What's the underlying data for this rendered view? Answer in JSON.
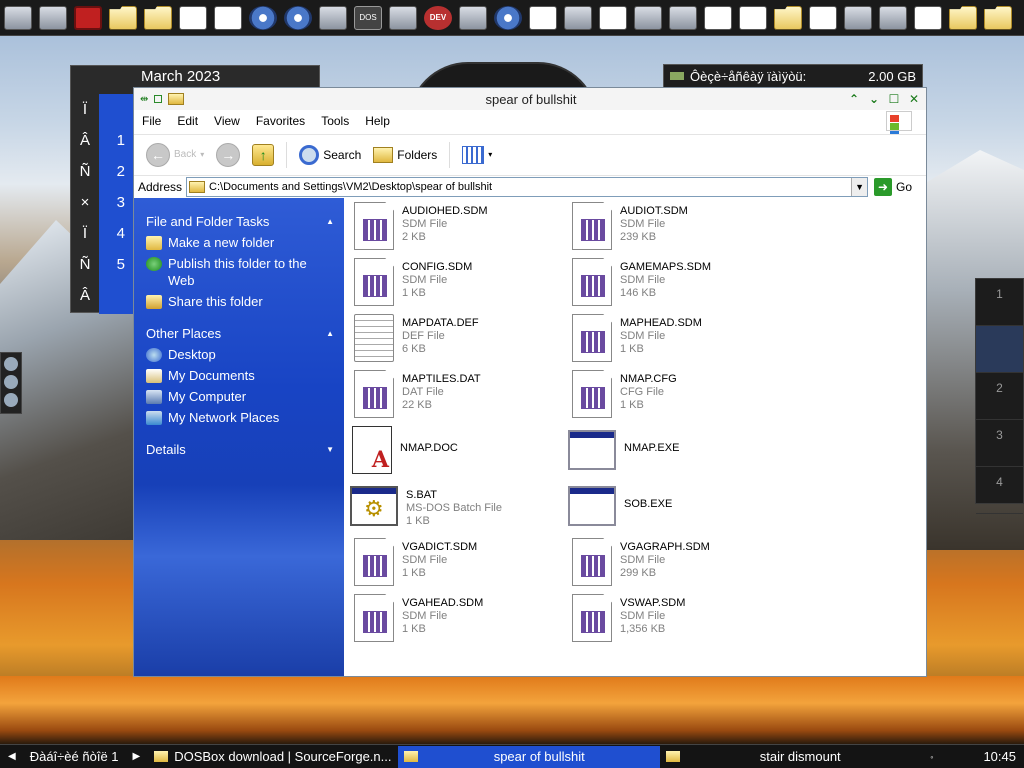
{
  "calendar": {
    "month": "March 2023",
    "weekdays": [
      "Ï",
      "Â",
      "Ñ",
      "×",
      "Ï",
      "Ñ",
      "Â"
    ],
    "dates": [
      "",
      "1",
      "2",
      "3",
      "4",
      "5"
    ]
  },
  "drive": {
    "label": "Ôèçè÷åñêàÿ ïàìÿòü:",
    "size": "2.00 GB"
  },
  "pager": [
    "1",
    "",
    "2",
    "3",
    "4"
  ],
  "window": {
    "title": "spear of bullshit",
    "menu": [
      "File",
      "Edit",
      "View",
      "Favorites",
      "Tools",
      "Help"
    ],
    "toolbar": {
      "back": "Back",
      "search": "Search",
      "folders": "Folders"
    },
    "address": {
      "label": "Address",
      "path": "C:\\Documents and Settings\\VM2\\Desktop\\spear of bullshit",
      "go": "Go"
    }
  },
  "taskpane": {
    "file_tasks": {
      "header": "File and Folder Tasks",
      "items": [
        "Make a new folder",
        "Publish this folder to the Web",
        "Share this folder"
      ]
    },
    "other_places": {
      "header": "Other Places",
      "items": [
        "Desktop",
        "My Documents",
        "My Computer",
        "My Network Places"
      ]
    },
    "details": {
      "header": "Details"
    }
  },
  "files": [
    {
      "name": "AUDIOHED.SDM",
      "type": "SDM File",
      "size": "2 KB"
    },
    {
      "name": "AUDIOT.SDM",
      "type": "SDM File",
      "size": "239 KB"
    },
    {
      "name": "CONFIG.SDM",
      "type": "SDM File",
      "size": "1 KB"
    },
    {
      "name": "GAMEMAPS.SDM",
      "type": "SDM File",
      "size": "146 KB"
    },
    {
      "name": "MAPDATA.DEF",
      "type": "DEF File",
      "size": "6 KB"
    },
    {
      "name": "MAPHEAD.SDM",
      "type": "SDM File",
      "size": "1 KB"
    },
    {
      "name": "MAPTILES.DAT",
      "type": "DAT File",
      "size": "22 KB"
    },
    {
      "name": "NMAP.CFG",
      "type": "CFG File",
      "size": "1 KB"
    },
    {
      "name": "NMAP.DOC",
      "type": "",
      "size": ""
    },
    {
      "name": "NMAP.EXE",
      "type": "",
      "size": ""
    },
    {
      "name": "S.BAT",
      "type": "MS-DOS Batch File",
      "size": "1 KB"
    },
    {
      "name": "SOB.EXE",
      "type": "",
      "size": ""
    },
    {
      "name": "VGADICT.SDM",
      "type": "SDM File",
      "size": "1 KB"
    },
    {
      "name": "VGAGRAPH.SDM",
      "type": "SDM File",
      "size": "299 KB"
    },
    {
      "name": "VGAHEAD.SDM",
      "type": "SDM File",
      "size": "1 KB"
    },
    {
      "name": "VSWAP.SDM",
      "type": "SDM File",
      "size": "1,356 KB"
    }
  ],
  "taskbar": {
    "tasks": [
      "Ðàáî÷èé ñòîë 1",
      "DOSBox download | SourceForge.n...",
      "spear of bullshit",
      "stair dismount"
    ],
    "clock": "10:45"
  }
}
